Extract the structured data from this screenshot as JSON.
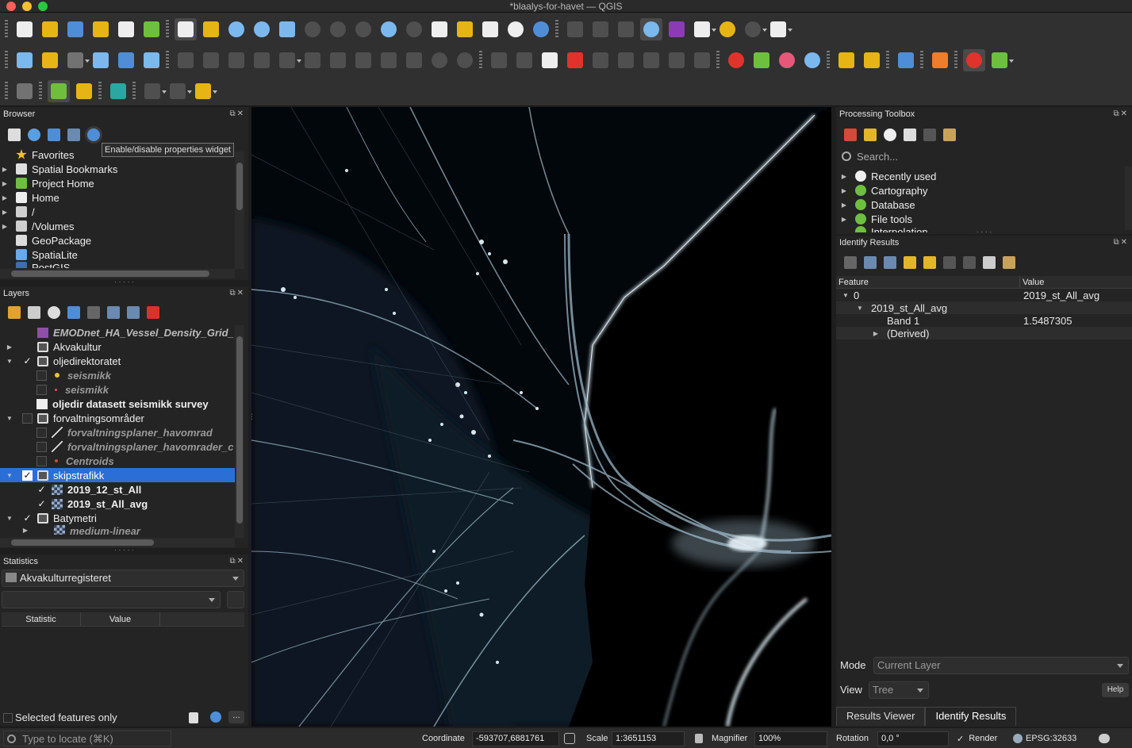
{
  "window": {
    "title": "*blaalys-for-havet — QGIS"
  },
  "browser": {
    "title": "Browser",
    "tooltip": "Enable/disable properties widget",
    "items": [
      {
        "label": "Favorites",
        "icon": "star-icon"
      },
      {
        "label": "Spatial Bookmarks",
        "icon": "bookmark-icon"
      },
      {
        "label": "Project Home",
        "icon": "project-home-icon"
      },
      {
        "label": "Home",
        "icon": "home-icon"
      },
      {
        "label": "/",
        "icon": "folder-icon"
      },
      {
        "label": "/Volumes",
        "icon": "folder-icon"
      },
      {
        "label": "GeoPackage",
        "icon": "geopackage-icon"
      },
      {
        "label": "SpatiaLite",
        "icon": "spatialite-icon"
      },
      {
        "label": "PostGIS",
        "icon": "postgis-icon"
      }
    ]
  },
  "layers": {
    "title": "Layers",
    "items": [
      {
        "label": "EMODnet_HA_Vessel_Density_Grid_"
      },
      {
        "label": "Akvakultur"
      },
      {
        "label": "oljedirektoratet"
      },
      {
        "label": "seismikk"
      },
      {
        "label": "seismikk"
      },
      {
        "label": "oljedir datasett seismikk survey"
      },
      {
        "label": "forvaltningsområder"
      },
      {
        "label": "forvaltningsplaner_havomrad"
      },
      {
        "label": "forvaltningsplaner_havomrader_c"
      },
      {
        "label": "Centroids"
      },
      {
        "label": "skipstrafikk"
      },
      {
        "label": "2019_12_st_All"
      },
      {
        "label": "2019_st_All_avg"
      },
      {
        "label": "Batymetri"
      },
      {
        "label": "medium-linear"
      }
    ]
  },
  "statistics": {
    "title": "Statistics",
    "layer": "Akvakulturregisteret",
    "columns": [
      "Statistic",
      "Value"
    ],
    "selected_only": "Selected features only"
  },
  "toolbox": {
    "title": "Processing Toolbox",
    "search_placeholder": "Search...",
    "items": [
      "Recently used",
      "Cartography",
      "Database",
      "File tools",
      "Interpolation"
    ]
  },
  "identify": {
    "title": "Identify Results",
    "columns": [
      "Feature",
      "Value"
    ],
    "rows": [
      {
        "feature": "0",
        "value": "2019_st_All_avg"
      },
      {
        "feature": "2019_st_All_avg",
        "value": ""
      },
      {
        "feature": "Band 1",
        "value": "1.5487305"
      },
      {
        "feature": "(Derived)",
        "value": ""
      }
    ],
    "mode_label": "Mode",
    "mode_value": "Current Layer",
    "view_label": "View",
    "view_value": "Tree",
    "help": "Help",
    "tabs": [
      "Results Viewer",
      "Identify Results"
    ]
  },
  "statusbar": {
    "locate_placeholder": "Type to locate (⌘K)",
    "coordinate_label": "Coordinate",
    "coordinate_value": "-593707,6881761",
    "scale_label": "Scale",
    "scale_value": "1:3651153",
    "magnifier_label": "Magnifier",
    "magnifier_value": "100%",
    "rotation_label": "Rotation",
    "rotation_value": "0,0 °",
    "render_label": "Render",
    "crs": "EPSG:32633"
  }
}
